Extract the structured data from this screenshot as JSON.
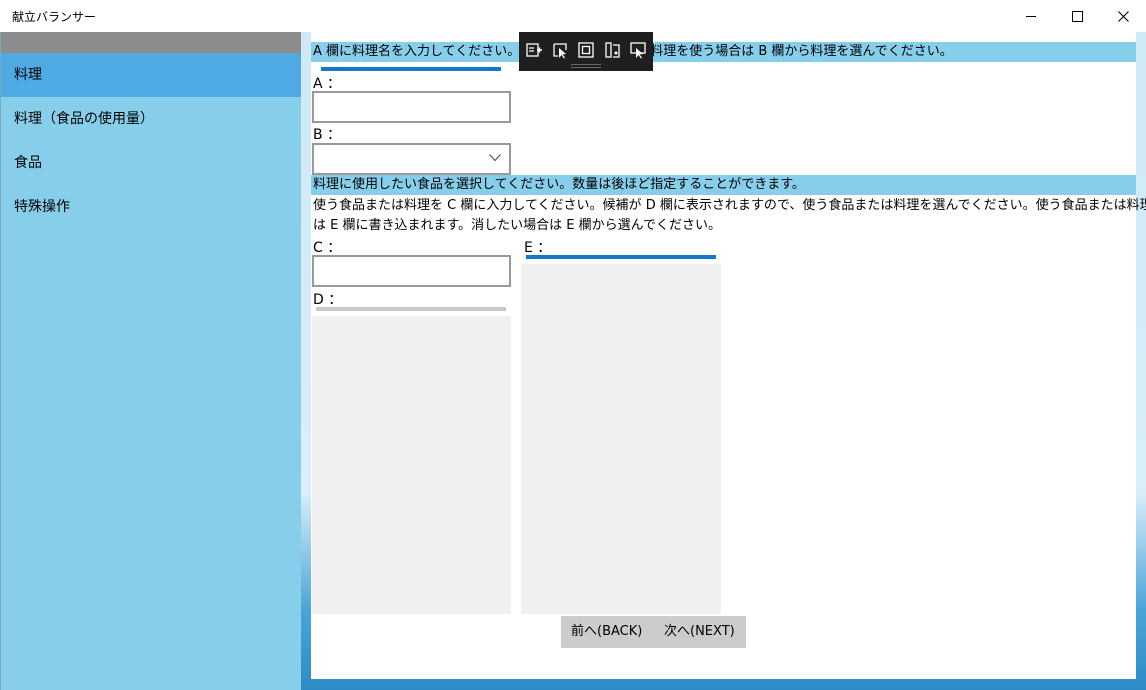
{
  "window": {
    "title": "献立バランサー"
  },
  "sidebar": {
    "items": [
      {
        "label": "料理",
        "active": true
      },
      {
        "label": "料理（食品の使用量）",
        "active": false
      },
      {
        "label": "食品",
        "active": false
      },
      {
        "label": "特殊操作",
        "active": false
      }
    ]
  },
  "main": {
    "banner1": "A 欄に料理名を入力してください。か　　　　　　　　　料理を使う場合は B 欄から料理を選んでください。",
    "label_a": "A ：",
    "label_b": "B ：",
    "banner2": "料理に使用したい食品を選択してください。数量は後ほど指定することができます。",
    "instructions_line1": "使う食品または料理を C 欄に入力してください。候補が D 欄に表示されますので、使う食品または料理を選んでください。使う食品または料理",
    "instructions_line2": "は E 欄に書き込まれます。消したい場合は E 欄から選んでください。",
    "label_c": "C ：",
    "label_d": "D ：",
    "label_e": "E ：",
    "input_a_value": "",
    "select_b_value": "",
    "input_c_value": ""
  },
  "buttons": {
    "back": "前へ(BACK)",
    "next": "次へ(NEXT)"
  },
  "debug_toolbar": {
    "icons": [
      "live-visual-tree-icon",
      "select-element-icon",
      "display-layout-adorners-icon",
      "track-focus-icon",
      "preview-selection-icon"
    ]
  },
  "colors": {
    "sidebar_bg": "#87ceeb",
    "sidebar_active": "#4fa9e3",
    "banner_bg": "#87ceeb",
    "accent_bar": "#1479c9",
    "button_bar": "#cccccc"
  }
}
